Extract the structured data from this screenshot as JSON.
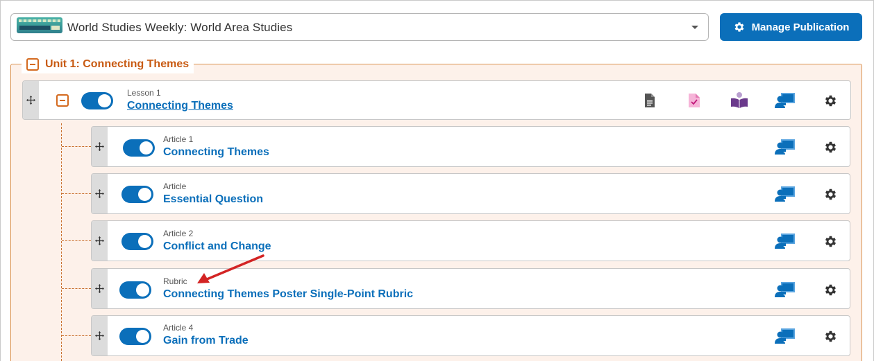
{
  "publication": {
    "selected": "World Studies Weekly: World Area Studies",
    "thumbnail_icon": "publication-cover-thumbnail"
  },
  "toolbar": {
    "manage_label": "Manage Publication"
  },
  "unit": {
    "title": "Unit 1: Connecting Themes",
    "collapse_icon": "minus-square-icon"
  },
  "lesson": {
    "kind": "Lesson 1",
    "title": "Connecting Themes",
    "enabled": true,
    "icons": [
      "document-icon",
      "assignment-check-icon",
      "reader-book-icon",
      "presentation-user-icon",
      "gear-icon"
    ]
  },
  "items": [
    {
      "kind": "Article 1",
      "title": "Connecting Themes",
      "enabled": true
    },
    {
      "kind": "Article",
      "title": "Essential Question",
      "enabled": true
    },
    {
      "kind": "Article 2",
      "title": "Conflict and Change",
      "enabled": true
    },
    {
      "kind": "Rubric",
      "title": "Connecting Themes Poster Single-Point Rubric",
      "enabled": true
    },
    {
      "kind": "Article 4",
      "title": "Gain from Trade",
      "enabled": true
    }
  ],
  "colors": {
    "primary": "#0b6fba",
    "unit_accent": "#c85a12",
    "unit_bg": "#fdf1ea",
    "annotation_arrow": "#d32424"
  }
}
